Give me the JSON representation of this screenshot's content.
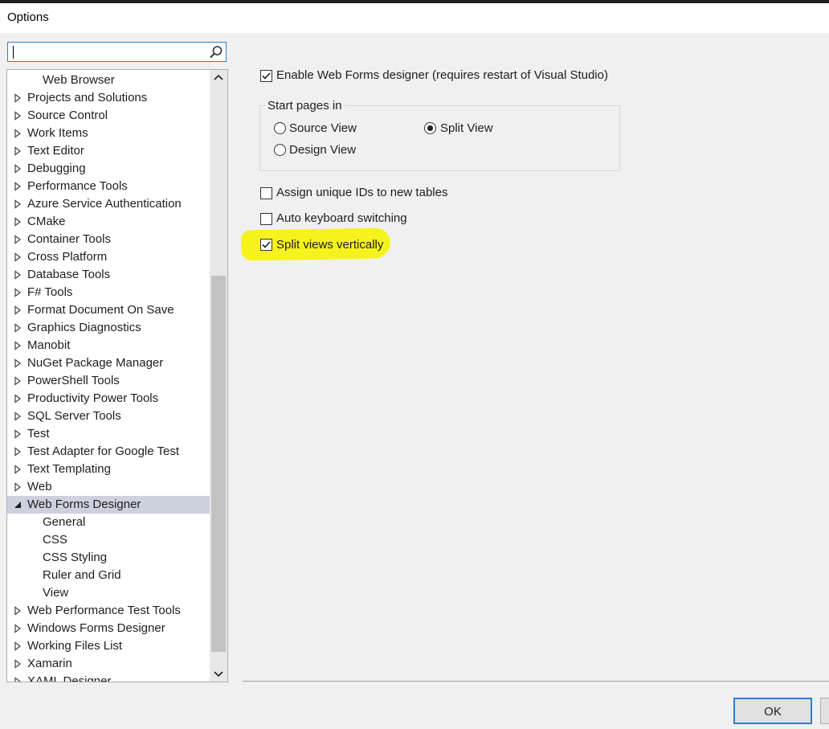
{
  "window": {
    "title": "Options"
  },
  "search": {
    "placeholder": "",
    "value": ""
  },
  "tree": {
    "items": [
      {
        "label": "Web Browser",
        "level": 1,
        "arrow": "none"
      },
      {
        "label": "Projects and Solutions",
        "level": 0,
        "arrow": "collapsed"
      },
      {
        "label": "Source Control",
        "level": 0,
        "arrow": "collapsed"
      },
      {
        "label": "Work Items",
        "level": 0,
        "arrow": "collapsed"
      },
      {
        "label": "Text Editor",
        "level": 0,
        "arrow": "collapsed"
      },
      {
        "label": "Debugging",
        "level": 0,
        "arrow": "collapsed"
      },
      {
        "label": "Performance Tools",
        "level": 0,
        "arrow": "collapsed"
      },
      {
        "label": "Azure Service Authentication",
        "level": 0,
        "arrow": "collapsed"
      },
      {
        "label": "CMake",
        "level": 0,
        "arrow": "collapsed"
      },
      {
        "label": "Container Tools",
        "level": 0,
        "arrow": "collapsed"
      },
      {
        "label": "Cross Platform",
        "level": 0,
        "arrow": "collapsed"
      },
      {
        "label": "Database Tools",
        "level": 0,
        "arrow": "collapsed"
      },
      {
        "label": "F# Tools",
        "level": 0,
        "arrow": "collapsed"
      },
      {
        "label": "Format Document On Save",
        "level": 0,
        "arrow": "collapsed"
      },
      {
        "label": "Graphics Diagnostics",
        "level": 0,
        "arrow": "collapsed"
      },
      {
        "label": "Manobit",
        "level": 0,
        "arrow": "collapsed"
      },
      {
        "label": "NuGet Package Manager",
        "level": 0,
        "arrow": "collapsed"
      },
      {
        "label": "PowerShell Tools",
        "level": 0,
        "arrow": "collapsed"
      },
      {
        "label": "Productivity Power Tools",
        "level": 0,
        "arrow": "collapsed"
      },
      {
        "label": "SQL Server Tools",
        "level": 0,
        "arrow": "collapsed"
      },
      {
        "label": "Test",
        "level": 0,
        "arrow": "collapsed"
      },
      {
        "label": "Test Adapter for Google Test",
        "level": 0,
        "arrow": "collapsed"
      },
      {
        "label": "Text Templating",
        "level": 0,
        "arrow": "collapsed"
      },
      {
        "label": "Web",
        "level": 0,
        "arrow": "collapsed"
      },
      {
        "label": "Web Forms Designer",
        "level": 0,
        "arrow": "expanded",
        "selected": true
      },
      {
        "label": "General",
        "level": 1,
        "arrow": "none"
      },
      {
        "label": "CSS",
        "level": 1,
        "arrow": "none"
      },
      {
        "label": "CSS Styling",
        "level": 1,
        "arrow": "none"
      },
      {
        "label": "Ruler and Grid",
        "level": 1,
        "arrow": "none"
      },
      {
        "label": "View",
        "level": 1,
        "arrow": "none"
      },
      {
        "label": "Web Performance Test Tools",
        "level": 0,
        "arrow": "collapsed"
      },
      {
        "label": "Windows Forms Designer",
        "level": 0,
        "arrow": "collapsed"
      },
      {
        "label": "Working Files List",
        "level": 0,
        "arrow": "collapsed"
      },
      {
        "label": "Xamarin",
        "level": 0,
        "arrow": "collapsed"
      },
      {
        "label": "XAML Designer",
        "level": 0,
        "arrow": "collapsed"
      }
    ]
  },
  "settings": {
    "enable_designer": {
      "label": "Enable Web Forms designer (requires restart of Visual Studio)",
      "checked": true
    },
    "start_pages": {
      "title": "Start pages in",
      "source_view": {
        "label": "Source View",
        "selected": false
      },
      "split_view": {
        "label": "Split View",
        "selected": true
      },
      "design_view": {
        "label": "Design View",
        "selected": false
      }
    },
    "assign_ids": {
      "label": "Assign unique IDs to new tables",
      "checked": false
    },
    "auto_keyboard": {
      "label": "Auto keyboard switching",
      "checked": false
    },
    "split_vertical": {
      "label": "Split views vertically",
      "checked": true,
      "highlight_color": "#f6f21e"
    }
  },
  "footer": {
    "ok_label": "OK"
  },
  "colors": {
    "accent": "#2f7fc9",
    "selection": "#cdd0dd"
  }
}
